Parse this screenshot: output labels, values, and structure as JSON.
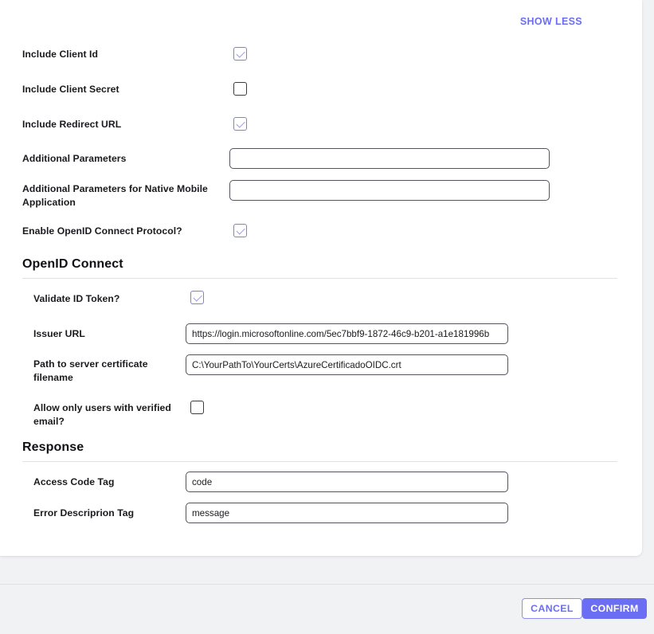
{
  "accent_color": "#6b6ef2",
  "card_background": "#ffffff",
  "page_background": "#f1f2f4",
  "header": {
    "show_less_label": "SHOW LESS"
  },
  "general_fields": [
    {
      "label": "Include Client Id",
      "type": "checkbox",
      "checked": true
    },
    {
      "label": "Include Client Secret",
      "type": "checkbox",
      "checked": false
    },
    {
      "label": "Include Redirect URL",
      "type": "checkbox",
      "checked": true
    },
    {
      "label": "Additional Parameters",
      "type": "text",
      "value": "",
      "placeholder": ""
    },
    {
      "label": "Additional Parameters for Native Mobile Application",
      "type": "text",
      "value": "",
      "placeholder": ""
    },
    {
      "label": "Enable OpenID Connect Protocol?",
      "type": "checkbox",
      "checked": true
    }
  ],
  "openid_section": {
    "heading": "OpenID Connect",
    "fields": [
      {
        "label": "Validate ID Token?",
        "type": "checkbox",
        "checked": true
      },
      {
        "label": "Issuer URL",
        "type": "text",
        "value": "https://login.microsoftonline.com/5ec7bbf9-1872-46c9-b201-a1e181996b",
        "placeholder": ""
      },
      {
        "label": "Path to server certificate filename",
        "type": "text",
        "value": "C:\\YourPathTo\\YourCerts\\AzureCertificadoOIDC.crt",
        "placeholder": ""
      },
      {
        "label": "Allow only users with verified email?",
        "type": "checkbox",
        "checked": false
      }
    ]
  },
  "response_section": {
    "heading": "Response",
    "fields": [
      {
        "label": "Access Code Tag",
        "type": "text",
        "value": "code",
        "placeholder": ""
      },
      {
        "label": "Error Descriprion Tag",
        "type": "text",
        "value": "message",
        "placeholder": ""
      }
    ]
  },
  "footer": {
    "cancel_label": "CANCEL",
    "confirm_label": "CONFIRM"
  }
}
